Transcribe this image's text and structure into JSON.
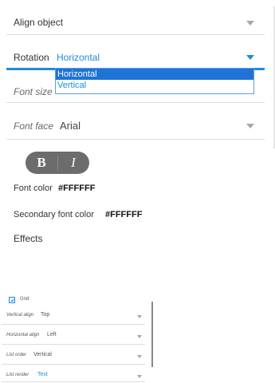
{
  "align_object": {
    "label": "Align object"
  },
  "rotation": {
    "label": "Rotation",
    "value": "Horizontal",
    "options": [
      "Horizontal",
      "Vertical"
    ]
  },
  "font_size": {
    "label": "Font size"
  },
  "font_face": {
    "label": "Font face",
    "value": "Arial"
  },
  "style_buttons": {
    "bold": "B",
    "italic": "I"
  },
  "font_color": {
    "label": "Font color",
    "value": "#FFFFFF"
  },
  "secondary_font_color": {
    "label": "Secondary font color",
    "value": "#FFFFFF"
  },
  "effects": {
    "label": "Effects"
  },
  "grid_panel": {
    "grid": {
      "label": "Grid",
      "checked": true
    },
    "vertical_align": {
      "label": "Vertical align",
      "value": "Top"
    },
    "horizontal_align": {
      "label": "Horizontal align",
      "value": "Left"
    },
    "list_order": {
      "label": "List order",
      "value": "Vertical"
    },
    "list_render": {
      "label": "List render",
      "value": "Text"
    }
  },
  "colors": {
    "accent": "#1e8bd8",
    "selected_option_bg": "#1e73d6",
    "pill": "#6c6c6c"
  }
}
